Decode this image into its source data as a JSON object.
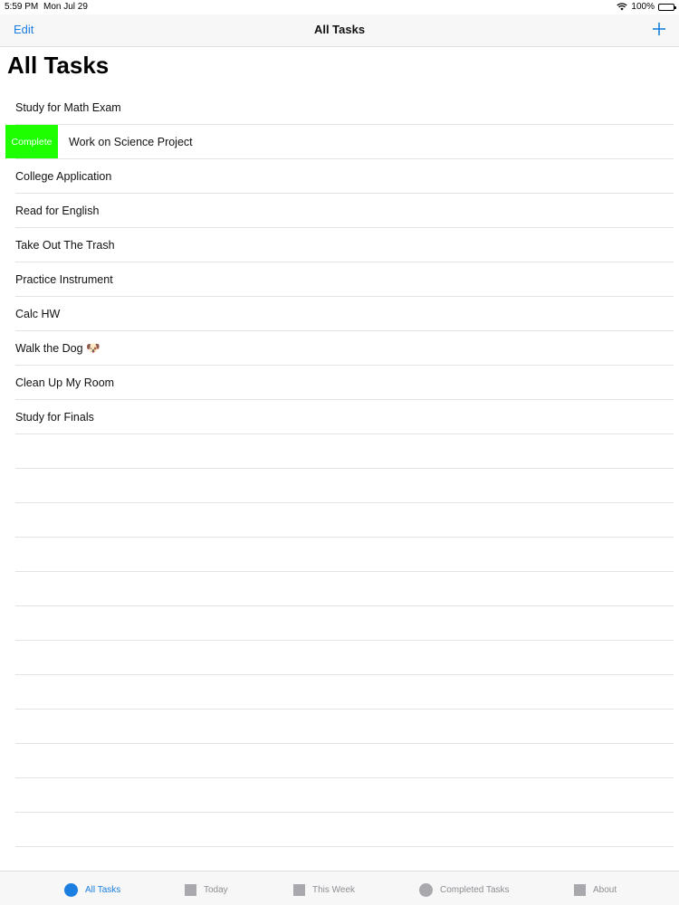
{
  "status": {
    "time": "5:59 PM",
    "date": "Mon Jul 29",
    "battery": "100%"
  },
  "nav": {
    "edit_label": "Edit",
    "title": "All Tasks"
  },
  "large_title": "All Tasks",
  "tasks": [
    "Study for Math Exam",
    "Work on Science Project",
    "College Application",
    "Read for English",
    "Take Out The Trash",
    "Practice Instrument",
    "Calc HW",
    "Walk the Dog 🐶",
    "Clean Up My Room",
    "Study for Finals"
  ],
  "swipe_action": {
    "label": "Complete",
    "color": "#1eff00"
  },
  "tabs": [
    {
      "label": "All Tasks",
      "icon": "circle-icon"
    },
    {
      "label": "Today",
      "icon": "square-icon"
    },
    {
      "label": "This Week",
      "icon": "square-icon"
    },
    {
      "label": "Completed Tasks",
      "icon": "circle-icon"
    },
    {
      "label": "About",
      "icon": "square-icon"
    }
  ],
  "colors": {
    "accent": "#1a7fe0",
    "inactive": "#8e8e93"
  }
}
